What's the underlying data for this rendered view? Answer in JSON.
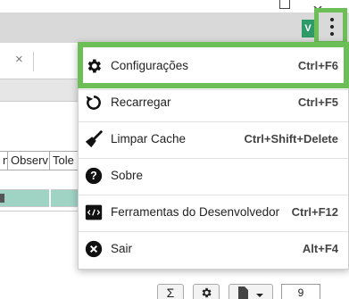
{
  "app": {
    "brand_mark": "V",
    "colors": {
      "highlight": "#6cbf56",
      "brand": "#2e9a68",
      "selected_row": "#9fd3c4"
    }
  },
  "window_controls": [
    "minimize-icon",
    "maximize-icon"
  ],
  "background": {
    "table_headers": [
      "n",
      "Observ",
      "Tole"
    ],
    "close_glyph": "×"
  },
  "menu": {
    "items": [
      {
        "icon": "gear-icon",
        "label": "Configurações",
        "shortcut": "Ctrl+F6",
        "highlighted": true
      },
      {
        "icon": "reload-icon",
        "label": "Recarregar",
        "shortcut": "Ctrl+F5"
      },
      {
        "icon": "broom-icon",
        "label": "Limpar Cache",
        "shortcut": "Ctrl+Shift+Delete"
      },
      {
        "icon": "help-icon",
        "label": "Sobre",
        "shortcut": ""
      },
      {
        "icon": "devtools-icon",
        "label": "Ferramentas do Desenvolvedor",
        "shortcut": "Ctrl+F12"
      },
      {
        "icon": "close-circle-icon",
        "label": "Sair",
        "shortcut": "Alt+F4"
      }
    ]
  },
  "toolbar": {
    "sum_label": "Σ",
    "page_value": "9"
  }
}
